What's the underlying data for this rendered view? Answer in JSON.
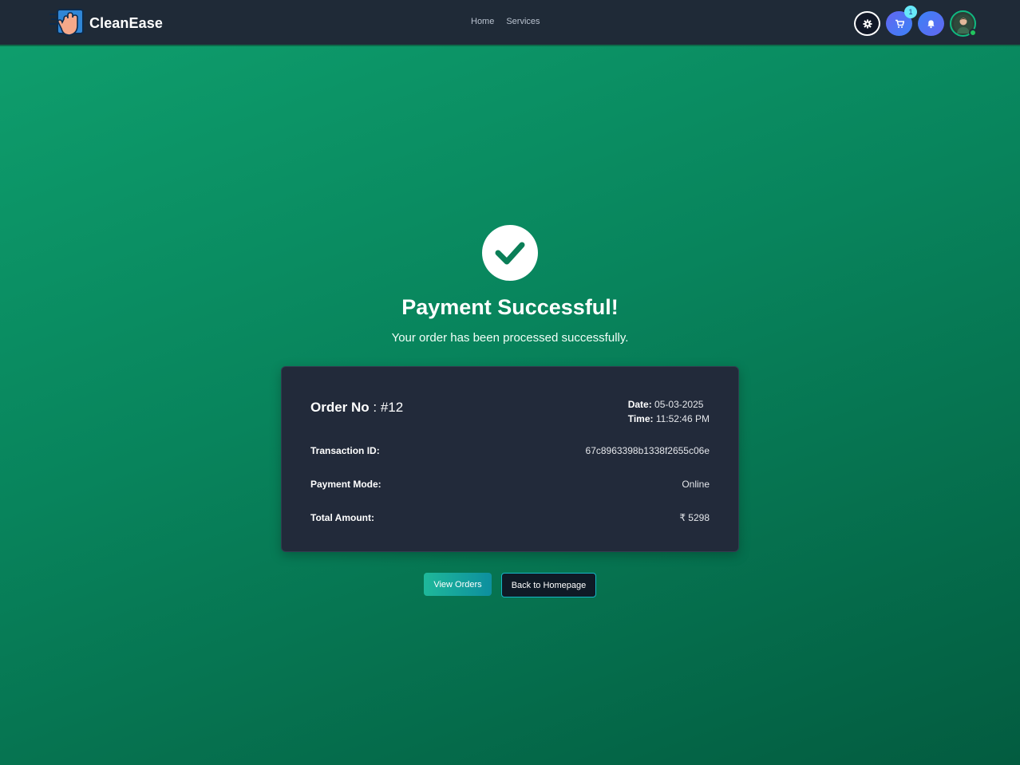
{
  "navbar": {
    "brand": "CleanEase",
    "links": [
      "Home",
      "Services"
    ],
    "icons": {
      "settings": "gear-icon",
      "cart": "cart-icon",
      "notifications": "bell-icon",
      "avatar": "user-avatar"
    },
    "cart_count": "1"
  },
  "main": {
    "title": "Payment Successful!",
    "subtitle": "Your order has been processed successfully.",
    "order": {
      "order_label": "Order No",
      "order_value": " : #12",
      "date_label": "Date:",
      "date_value": " 05-03-2025",
      "time_label": "Time:",
      "time_value": " 11:52:46 PM",
      "rows": [
        {
          "label": "Transaction ID:",
          "value": "67c8963398b1338f2655c06e"
        },
        {
          "label": "Payment Mode:",
          "value": "Online"
        },
        {
          "label": "Total Amount:",
          "value": "₹ 5298"
        }
      ]
    },
    "buttons": {
      "view_orders": "View Orders",
      "back_home": "Back to Homepage"
    }
  },
  "colors": {
    "navbar_bg": "#1f2a37",
    "page_gradient_start": "#0fa06e",
    "page_gradient_end": "#035c40",
    "card_bg": "#222a3a",
    "check_color": "#0a7e57"
  }
}
